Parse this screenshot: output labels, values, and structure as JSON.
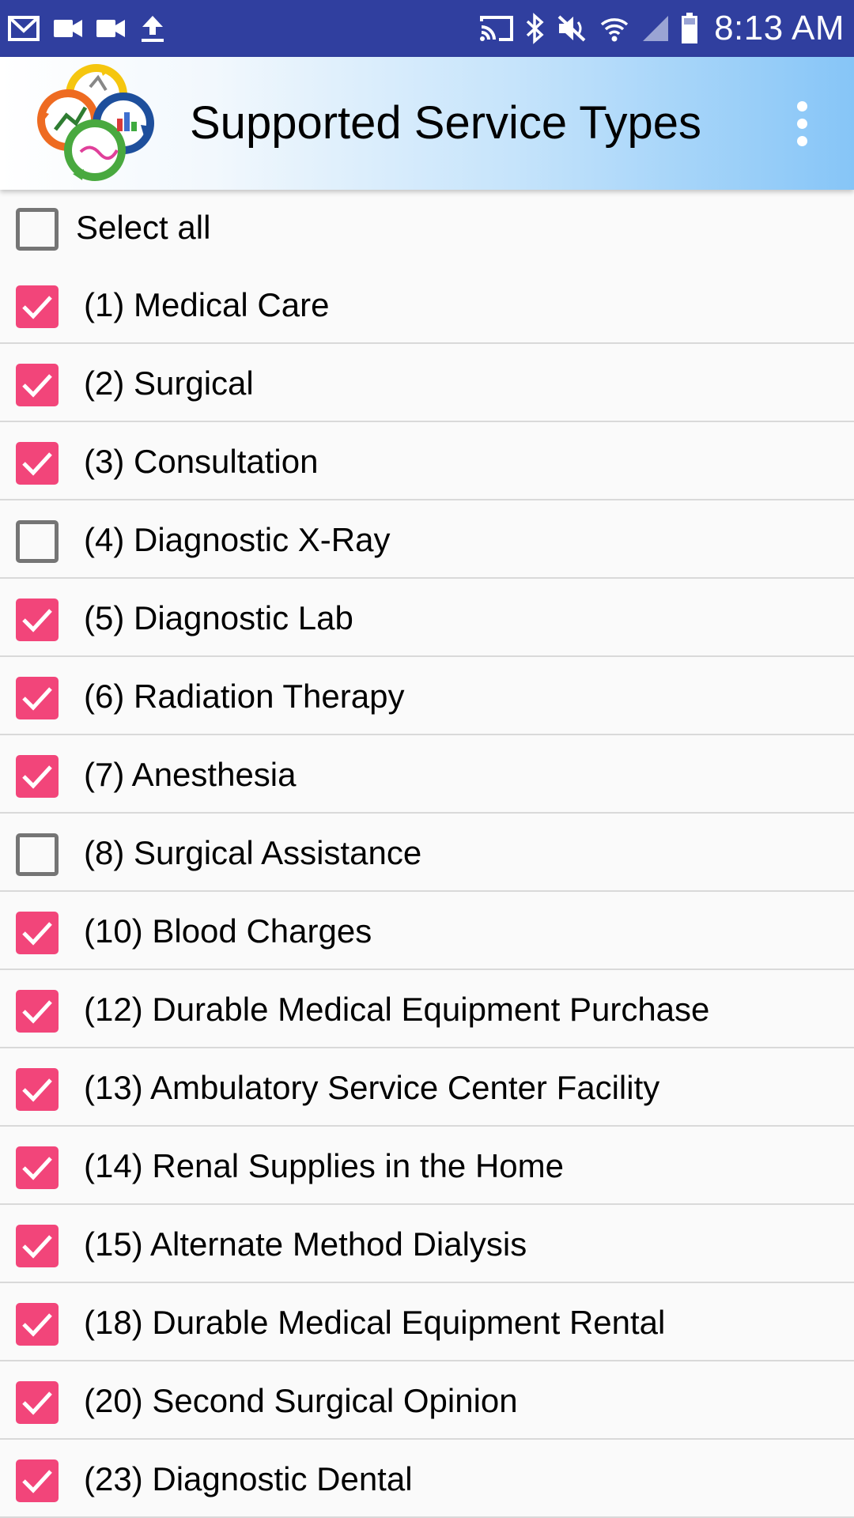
{
  "status_bar": {
    "time": "8:13 AM",
    "icons": [
      "gmail-icon",
      "video-camera-icon",
      "video-camera-icon",
      "upload-icon",
      "cast-icon",
      "bluetooth-icon",
      "vibrate-mute-icon",
      "wifi-icon",
      "signal-icon",
      "battery-icon"
    ]
  },
  "app_bar": {
    "title": "Supported Service Types",
    "logo": "app-logo",
    "overflow_icon": "more-vert-icon"
  },
  "select_all": {
    "label": "Select all",
    "checked": false
  },
  "accent_color": "#f2457a",
  "items": [
    {
      "label": "(1) Medical Care",
      "checked": true
    },
    {
      "label": "(2) Surgical",
      "checked": true
    },
    {
      "label": "(3) Consultation",
      "checked": true
    },
    {
      "label": "(4) Diagnostic X-Ray",
      "checked": false
    },
    {
      "label": "(5) Diagnostic Lab",
      "checked": true
    },
    {
      "label": "(6) Radiation Therapy",
      "checked": true
    },
    {
      "label": "(7) Anesthesia",
      "checked": true
    },
    {
      "label": "(8) Surgical Assistance",
      "checked": false
    },
    {
      "label": "(10) Blood Charges",
      "checked": true
    },
    {
      "label": "(12) Durable Medical Equipment Purchase",
      "checked": true
    },
    {
      "label": "(13) Ambulatory Service Center Facility",
      "checked": true
    },
    {
      "label": "(14) Renal Supplies in the Home",
      "checked": true
    },
    {
      "label": "(15) Alternate Method Dialysis",
      "checked": true
    },
    {
      "label": "(18) Durable Medical Equipment Rental",
      "checked": true
    },
    {
      "label": "(20) Second Surgical Opinion",
      "checked": true
    },
    {
      "label": "(23) Diagnostic Dental",
      "checked": true
    }
  ]
}
